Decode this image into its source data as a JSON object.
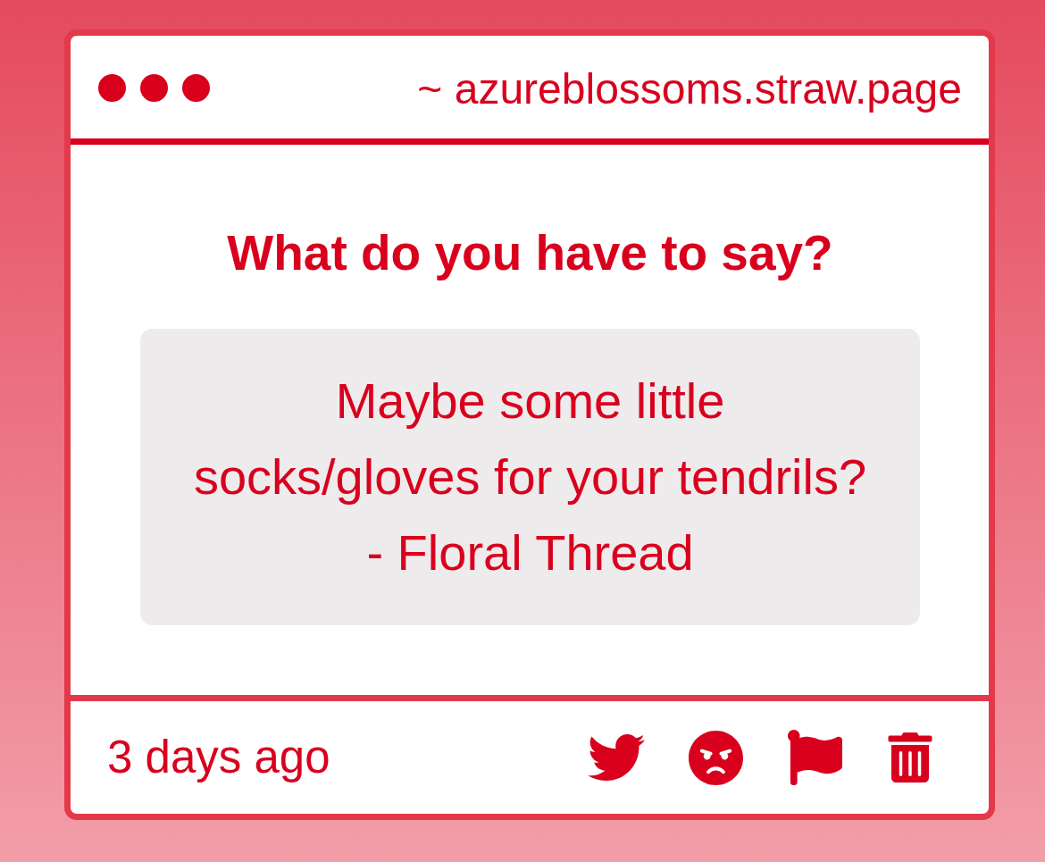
{
  "window": {
    "url": "~ azureblossoms.straw.page"
  },
  "prompt": {
    "title": "What do you have to say?"
  },
  "message": {
    "text": "Maybe some little\nsocks/gloves for your tendrils?\n- Floral Thread"
  },
  "footer": {
    "time": "3 days ago"
  }
}
